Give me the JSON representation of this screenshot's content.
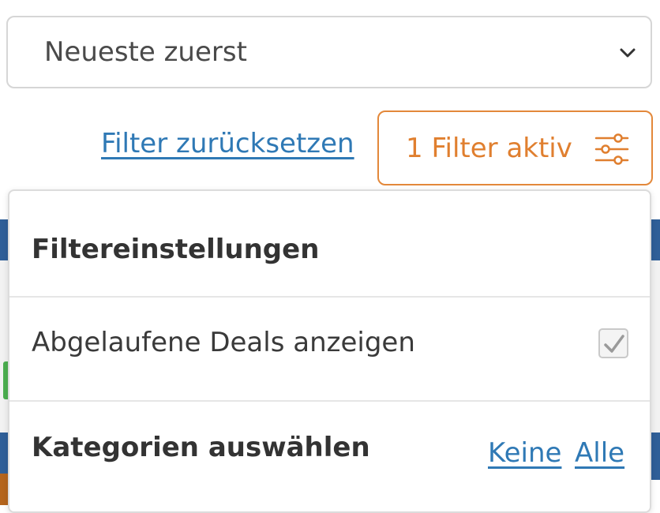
{
  "sort": {
    "selected": "Neueste zuerst"
  },
  "filters": {
    "reset_label": "Filter zurücksetzen",
    "active_label": "1 Filter aktiv"
  },
  "panel": {
    "title": "Filtereinstellungen",
    "expired_label": "Abgelaufene Deals anzeigen",
    "expired_checked": true,
    "categories_title": "Kategorien auswählen",
    "none_label": "Keine",
    "all_label": "Alle"
  },
  "colors": {
    "accent_orange": "#e07f2f",
    "link_blue": "#2f79b5",
    "header_blue": "#2f5f98"
  },
  "icons": {
    "sort_chevron": "chevron-down-icon",
    "filter_settings": "sliders-icon",
    "checkbox_check": "check-icon"
  }
}
